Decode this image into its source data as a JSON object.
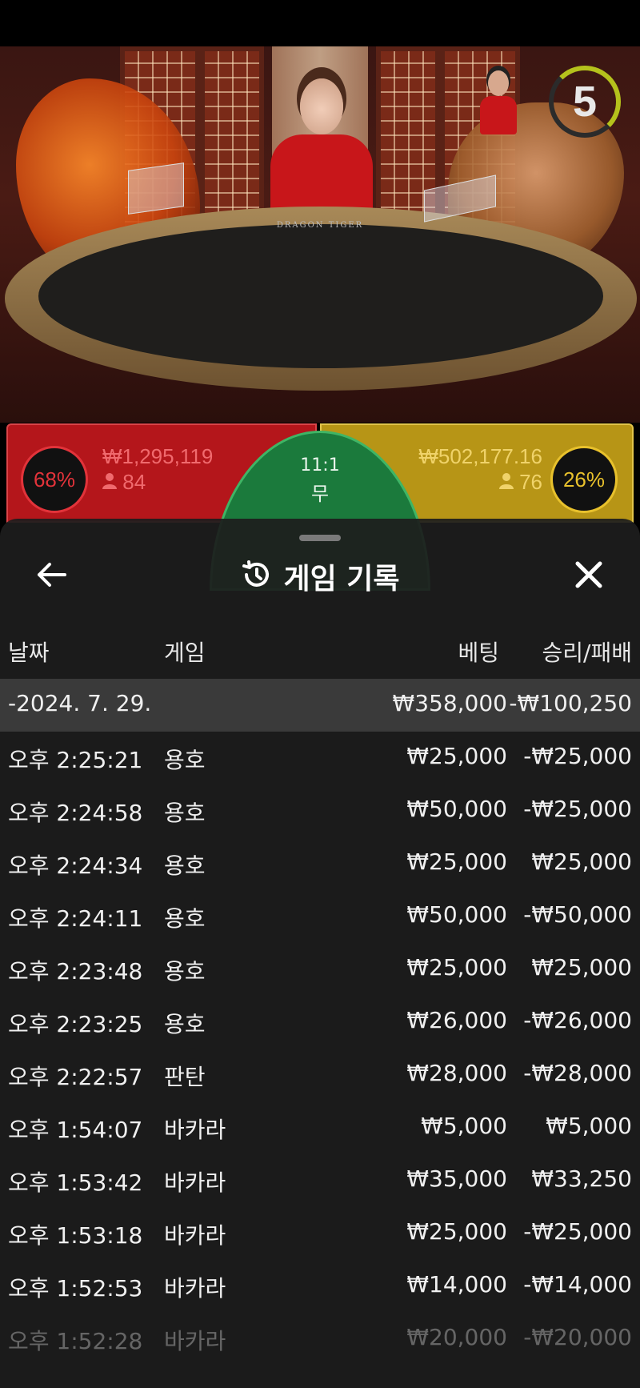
{
  "scene": {
    "table_label": "DRAGON  TIGER",
    "countdown": "5"
  },
  "bets": {
    "dragon": {
      "percent": "68%",
      "amount": "₩1,295,119",
      "players": "84"
    },
    "tiger": {
      "percent": "26%",
      "amount": "₩502,177.16",
      "players": "76"
    },
    "tie": {
      "ratio": "11:1",
      "label": "무"
    }
  },
  "history": {
    "title": "게임 기록",
    "columns": {
      "date": "날짜",
      "game": "게임",
      "bet": "베팅",
      "result": "승리/패배"
    },
    "day": {
      "date": "-2024. 7. 29.",
      "bet": "₩358,000",
      "result": "-₩100,250"
    },
    "rows": [
      {
        "time": "오후 2:25:21",
        "game": "용호",
        "bet": "₩25,000",
        "result": "-₩25,000"
      },
      {
        "time": "오후 2:24:58",
        "game": "용호",
        "bet": "₩50,000",
        "result": "-₩25,000"
      },
      {
        "time": "오후 2:24:34",
        "game": "용호",
        "bet": "₩25,000",
        "result": "₩25,000"
      },
      {
        "time": "오후 2:24:11",
        "game": "용호",
        "bet": "₩50,000",
        "result": "-₩50,000"
      },
      {
        "time": "오후 2:23:48",
        "game": "용호",
        "bet": "₩25,000",
        "result": "₩25,000"
      },
      {
        "time": "오후 2:23:25",
        "game": "용호",
        "bet": "₩26,000",
        "result": "-₩26,000"
      },
      {
        "time": "오후 2:22:57",
        "game": "판탄",
        "bet": "₩28,000",
        "result": "-₩28,000"
      },
      {
        "time": "오후 1:54:07",
        "game": "바카라",
        "bet": "₩5,000",
        "result": "₩5,000"
      },
      {
        "time": "오후 1:53:42",
        "game": "바카라",
        "bet": "₩35,000",
        "result": "₩33,250"
      },
      {
        "time": "오후 1:53:18",
        "game": "바카라",
        "bet": "₩25,000",
        "result": "-₩25,000"
      },
      {
        "time": "오후 1:52:53",
        "game": "바카라",
        "bet": "₩14,000",
        "result": "-₩14,000"
      },
      {
        "time": "오후 1:52:28",
        "game": "바카라",
        "bet": "₩20,000",
        "result": "-₩20,000"
      }
    ]
  },
  "icons": {
    "back": "arrow-left-icon",
    "history": "history-clock-icon",
    "close": "close-x-icon",
    "player": "person-icon"
  },
  "colors": {
    "dragon": "#b4161b",
    "tiger": "#b79516",
    "tie": "#1b7a3c",
    "sheet": "#1d1d1d",
    "day_row": "#3a3a3a"
  }
}
